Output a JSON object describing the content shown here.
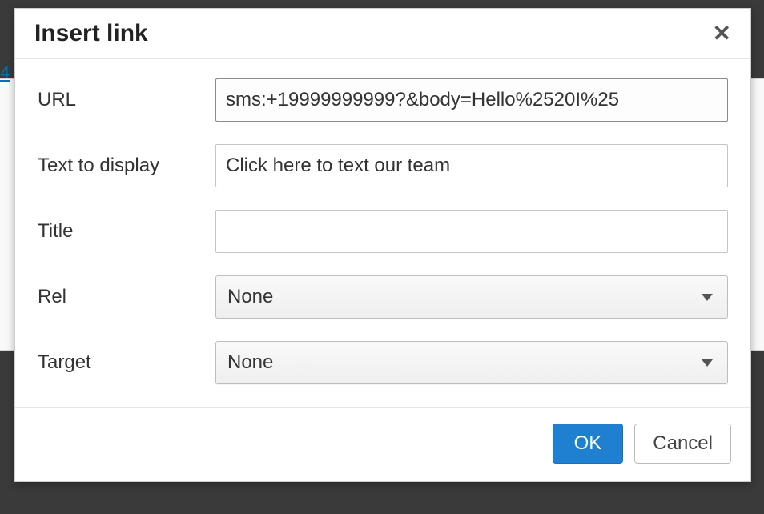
{
  "dialog": {
    "title": "Insert link",
    "close_aria": "Close"
  },
  "fields": {
    "url": {
      "label": "URL",
      "value": "sms:+19999999999?&body=Hello%2520I%25"
    },
    "text_to_display": {
      "label": "Text to display",
      "value": "Click here to text our team"
    },
    "title": {
      "label": "Title",
      "value": ""
    },
    "rel": {
      "label": "Rel",
      "selected": "None"
    },
    "target": {
      "label": "Target",
      "selected": "None"
    }
  },
  "buttons": {
    "ok": "OK",
    "cancel": "Cancel"
  },
  "background": {
    "link_fragment": "4"
  }
}
